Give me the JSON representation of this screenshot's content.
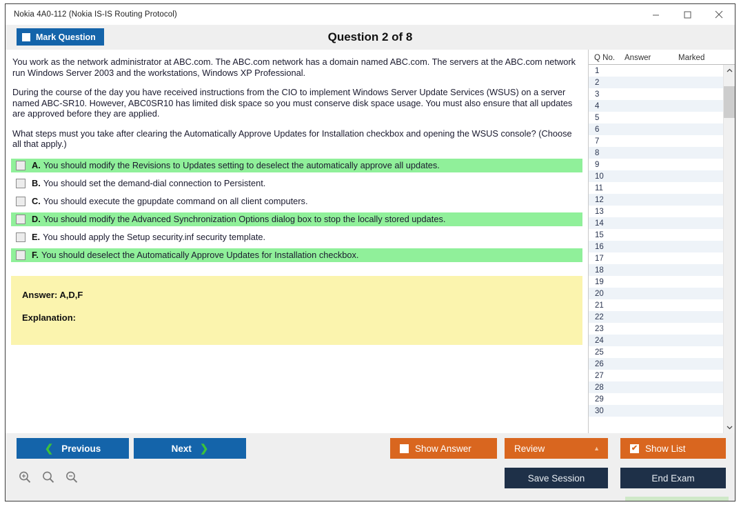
{
  "window": {
    "title": "Nokia 4A0-112 (Nokia IS-IS Routing Protocol)",
    "minimize_label": "minimize",
    "maximize_label": "maximize",
    "close_label": "close"
  },
  "header": {
    "mark_question_label": "Mark Question",
    "question_title": "Question 2 of 8"
  },
  "question": {
    "paragraphs": [
      "You work as the network administrator at ABC.com. The ABC.com network has a domain named ABC.com. The servers at the ABC.com network run Windows Server 2003 and the workstations, Windows XP Professional.",
      "During the course of the day you have received instructions from the CIO to implement Windows Server Update Services (WSUS) on a server named ABC-SR10. However, ABC0SR10 has limited disk space so you must conserve disk space usage. You must also ensure that all updates are approved before they are applied.",
      "What steps must you take after clearing the Automatically Approve Updates for Installation checkbox and opening the WSUS console? (Choose all that apply.)"
    ]
  },
  "options": [
    {
      "letter": "A.",
      "text": "You should modify the Revisions to Updates setting to deselect the automatically approve all updates.",
      "highlighted": true,
      "checked": false
    },
    {
      "letter": "B.",
      "text": "You should set the demand-dial connection to Persistent.",
      "highlighted": false,
      "checked": false
    },
    {
      "letter": "C.",
      "text": "You should execute the gpupdate command on all client computers.",
      "highlighted": false,
      "checked": false
    },
    {
      "letter": "D.",
      "text": "You should modify the Advanced Synchronization Options dialog box to stop the locally stored updates.",
      "highlighted": true,
      "checked": false
    },
    {
      "letter": "E.",
      "text": "You should apply the Setup security.inf security template.",
      "highlighted": false,
      "checked": false
    },
    {
      "letter": "F.",
      "text": "You should deselect the Automatically Approve Updates for Installation checkbox.",
      "highlighted": true,
      "checked": false
    }
  ],
  "answer_panel": {
    "answer_label": "Answer: A,D,F",
    "explanation_label": "Explanation:"
  },
  "question_list": {
    "columns": [
      "Q No.",
      "Answer",
      "Marked"
    ],
    "rows": [
      {
        "no": "1",
        "answer": "",
        "marked": ""
      },
      {
        "no": "2",
        "answer": "",
        "marked": ""
      },
      {
        "no": "3",
        "answer": "",
        "marked": ""
      },
      {
        "no": "4",
        "answer": "",
        "marked": ""
      },
      {
        "no": "5",
        "answer": "",
        "marked": ""
      },
      {
        "no": "6",
        "answer": "",
        "marked": ""
      },
      {
        "no": "7",
        "answer": "",
        "marked": ""
      },
      {
        "no": "8",
        "answer": "",
        "marked": ""
      },
      {
        "no": "9",
        "answer": "",
        "marked": ""
      },
      {
        "no": "10",
        "answer": "",
        "marked": ""
      },
      {
        "no": "11",
        "answer": "",
        "marked": ""
      },
      {
        "no": "12",
        "answer": "",
        "marked": ""
      },
      {
        "no": "13",
        "answer": "",
        "marked": ""
      },
      {
        "no": "14",
        "answer": "",
        "marked": ""
      },
      {
        "no": "15",
        "answer": "",
        "marked": ""
      },
      {
        "no": "16",
        "answer": "",
        "marked": ""
      },
      {
        "no": "17",
        "answer": "",
        "marked": ""
      },
      {
        "no": "18",
        "answer": "",
        "marked": ""
      },
      {
        "no": "19",
        "answer": "",
        "marked": ""
      },
      {
        "no": "20",
        "answer": "",
        "marked": ""
      },
      {
        "no": "21",
        "answer": "",
        "marked": ""
      },
      {
        "no": "22",
        "answer": "",
        "marked": ""
      },
      {
        "no": "23",
        "answer": "",
        "marked": ""
      },
      {
        "no": "24",
        "answer": "",
        "marked": ""
      },
      {
        "no": "25",
        "answer": "",
        "marked": ""
      },
      {
        "no": "26",
        "answer": "",
        "marked": ""
      },
      {
        "no": "27",
        "answer": "",
        "marked": ""
      },
      {
        "no": "28",
        "answer": "",
        "marked": ""
      },
      {
        "no": "29",
        "answer": "",
        "marked": ""
      },
      {
        "no": "30",
        "answer": "",
        "marked": ""
      }
    ],
    "scroll_up_glyph": "ⱏ",
    "scroll_down_glyph": "ⱐ29"
  },
  "footer": {
    "previous_label": "Previous",
    "next_label": "Next",
    "prev_chevron": "❮",
    "next_chevron": "❯",
    "show_answer_label": "Show Answer",
    "show_answer_checked": false,
    "review_label": "Review",
    "review_arrow": "▲",
    "show_list_label": "Show List",
    "show_list_checked": true,
    "show_list_check_glyph": "✔",
    "save_session_label": "Save Session",
    "end_exam_label": "End Exam",
    "zoom_in_label": "zoom-in",
    "zoom_reset_label": "zoom-reset",
    "zoom_out_label": "zoom-out"
  },
  "colors": {
    "primary_blue": "#1464aa",
    "orange": "#d9661f",
    "navy": "#1e3048",
    "highlight_green": "#90f09a",
    "answer_yellow": "#fbf4ae"
  }
}
